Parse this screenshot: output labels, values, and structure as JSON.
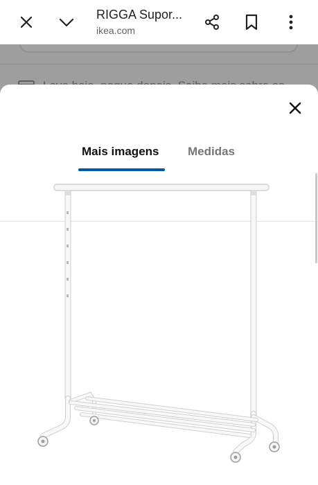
{
  "browser": {
    "title": "RIGGA Supor...",
    "url": "ikea.com"
  },
  "background_page": {
    "promo_text": "Leve hoje, pague depois. Saiba mais sobre as"
  },
  "sheet": {
    "tabs": [
      {
        "label": "Mais imagens",
        "active": true
      },
      {
        "label": "Medidas",
        "active": false
      }
    ],
    "image_subject": "white clothes rack on wheels"
  },
  "colors": {
    "accent": "#0058a3",
    "active_tab_text": "#111111",
    "inactive_tab_text": "#767676",
    "backdrop": "#9e9e9e"
  },
  "icons": [
    "close-icon",
    "chevron-down-icon",
    "share-icon",
    "bookmark-icon",
    "more-vert-icon",
    "credit-card-icon",
    "close-icon"
  ]
}
